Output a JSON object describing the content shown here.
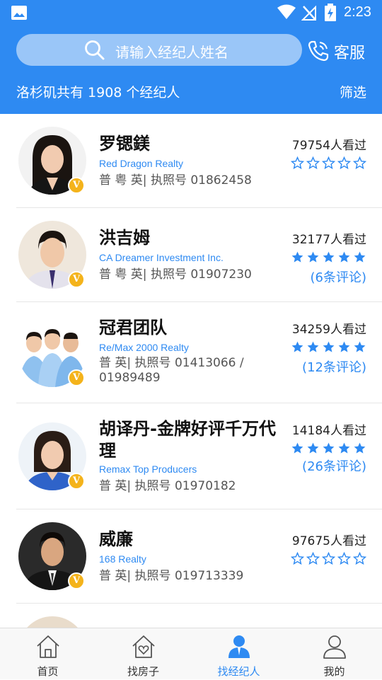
{
  "status_bar": {
    "time": "2:23",
    "icons": [
      "image-icon",
      "wifi-icon",
      "no-signal-icon",
      "battery-charging-icon"
    ]
  },
  "search": {
    "placeholder": "请输入经纪人姓名"
  },
  "service": {
    "label": "客服",
    "icon": "phone-icon"
  },
  "summary": {
    "text": "洛杉矶共有 1908 个经纪人",
    "filter_label": "筛选"
  },
  "colors": {
    "primary": "#2e8af2",
    "badge": "#f4b31b"
  },
  "agents": [
    {
      "name": "罗锶鎂",
      "company": "Red Dragon Realty",
      "license": "普 粤 英| 执照号 01862458",
      "views": "79754人看过",
      "rating": 0,
      "reviews": "",
      "badge": "V"
    },
    {
      "name": "洪吉姆",
      "company": "CA Dreamer Investment Inc.",
      "license": "普 粤 英| 执照号 01907230",
      "views": "32177人看过",
      "rating": 5,
      "reviews": "(6条评论)",
      "badge": "V"
    },
    {
      "name": "冠君团队",
      "company": "Re/Max 2000 Realty",
      "license": "普 英| 执照号 01413066 / 01989489",
      "views": "34259人看过",
      "rating": 5,
      "reviews": "(12条评论)",
      "badge": "V"
    },
    {
      "name": "胡译丹-金牌好评千万代理",
      "company": "Remax Top Producers",
      "license": "普 英| 执照号 01970182",
      "views": "14184人看过",
      "rating": 5,
      "reviews": "(26条评论)",
      "badge": "V"
    },
    {
      "name": "威廉",
      "company": "168 Realty",
      "license": "普 英| 执照号 019713339",
      "views": "97675人看过",
      "rating": 0,
      "reviews": "",
      "badge": "V"
    }
  ],
  "tabs": [
    {
      "label": "首页",
      "icon": "home-icon",
      "active": false
    },
    {
      "label": "找房子",
      "icon": "house-heart-icon",
      "active": false
    },
    {
      "label": "找经纪人",
      "icon": "agent-icon",
      "active": true
    },
    {
      "label": "我的",
      "icon": "profile-icon",
      "active": false
    }
  ]
}
